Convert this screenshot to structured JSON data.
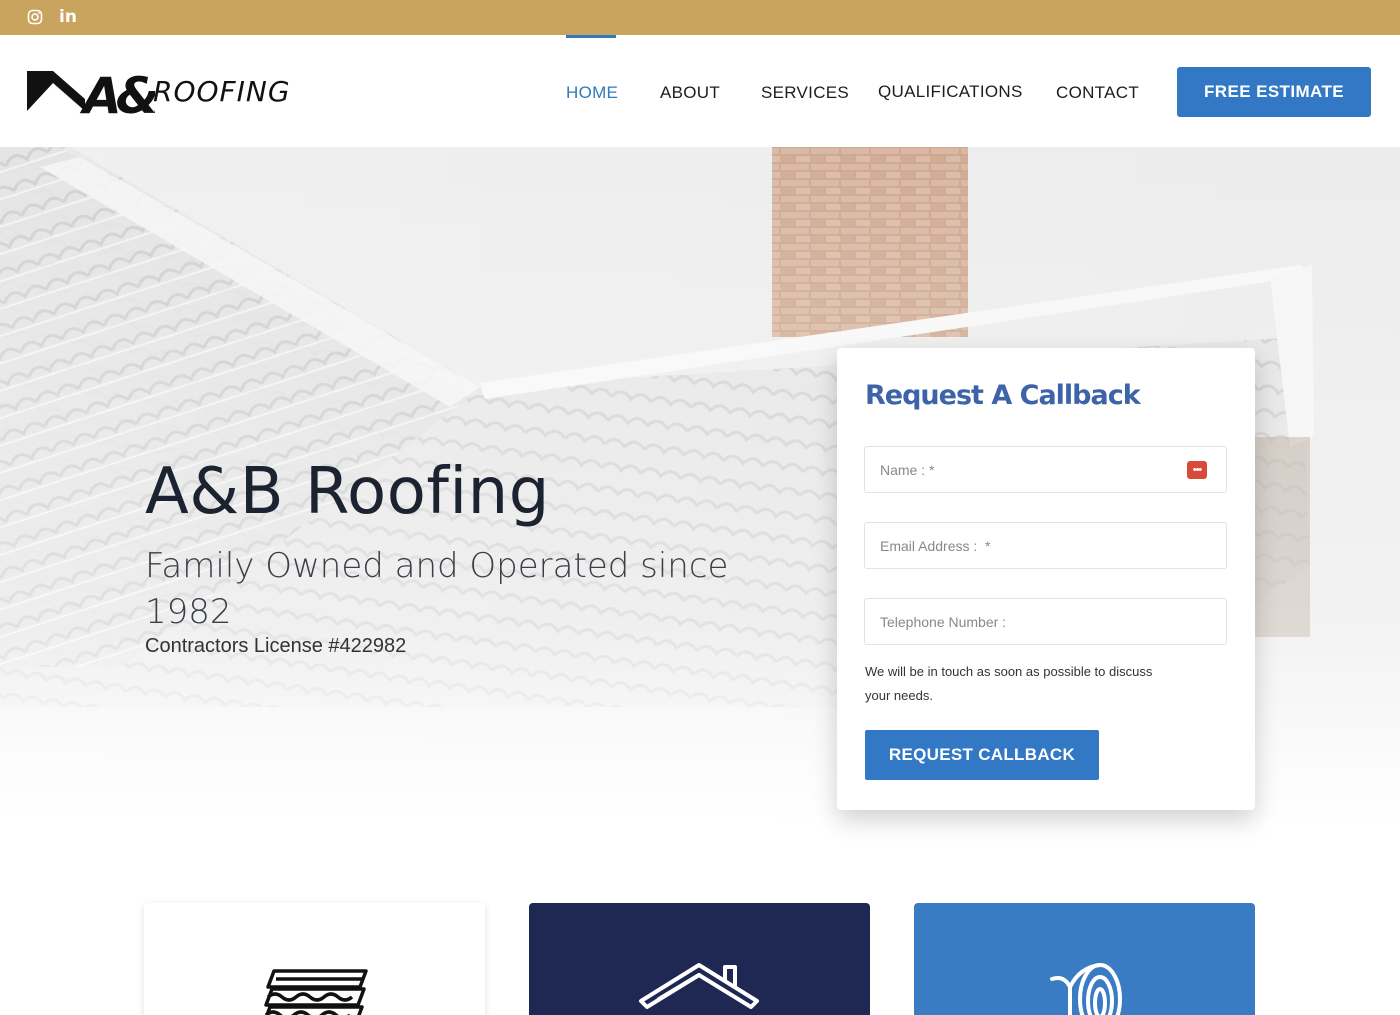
{
  "topbar": {
    "social": [
      {
        "icon": "instagram-icon"
      },
      {
        "icon": "linkedin-icon",
        "glyph": "in"
      }
    ]
  },
  "header": {
    "logo_text": "ROOFING",
    "logo_mark": "A&B",
    "nav": [
      {
        "label": "HOME",
        "active": true
      },
      {
        "label": "ABOUT"
      },
      {
        "label": "SERVICES"
      },
      {
        "label": "QUALIFICATIONS"
      },
      {
        "label": "CONTACT"
      }
    ],
    "cta_label": "FREE ESTIMATE"
  },
  "hero": {
    "title": "A&B Roofing",
    "subtitle": "Family Owned and Operated since 1982",
    "license": "Contractors License #422982"
  },
  "callback_form": {
    "title": "Request A Callback",
    "name_placeholder": "Name : *",
    "email_placeholder": "Email Address :  *",
    "telephone_placeholder": "Telephone Number :",
    "note": "We will be in touch as soon as possible to discuss your needs.",
    "submit_label": "REQUEST CALLBACK",
    "password_manager_icon": "dots-icon"
  },
  "services": [
    {
      "icon": "roof-tiles-icon"
    },
    {
      "icon": "house-roof-icon"
    },
    {
      "icon": "roll-icon"
    }
  ],
  "colors": {
    "topbar": "#c9a45f",
    "accent_blue": "#3278c5",
    "navy": "#1f2753",
    "title_blue": "#3d63a8"
  }
}
